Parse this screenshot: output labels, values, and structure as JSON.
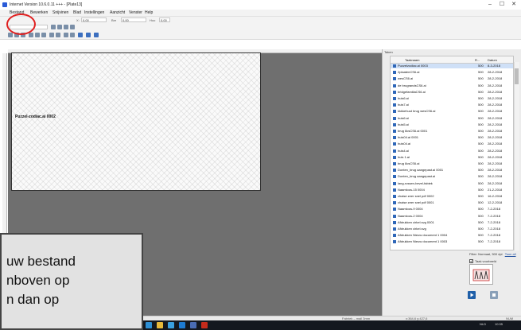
{
  "window": {
    "title": "Internet Version 10.6.0.11 +++ - [Plate13]",
    "controls": [
      "–",
      "☐",
      "✕"
    ]
  },
  "menu": [
    "Bestand",
    "Bewerken",
    "Snijvinen",
    "Blad",
    "Instellingen",
    "Aanzicht",
    "Venster",
    "Help"
  ],
  "toolbar": {
    "x_label": "X:",
    "x_value": "0,00",
    "width_label": "Bre",
    "width_value": "0,00",
    "height_label": "Hoo",
    "height_value": "0,00"
  },
  "plate": {
    "label": "Puzzel-zodiac.ai 0002"
  },
  "panel": {
    "title": "Taken",
    "columns": [
      "Taaknaam",
      "R...",
      "Datum"
    ],
    "rows": [
      {
        "name": "Puzzelzodiac.ai 0003",
        "res": "500",
        "date": "8-3-2018",
        "selected": true
      },
      {
        "name": "2plaatenCS6.ai",
        "res": "500",
        "date": "28-2-2018"
      },
      {
        "name": "wesCS6.ai",
        "res": "500",
        "date": "28-2-2018"
      },
      {
        "name": "de brugrandsCS6.ai",
        "res": "500",
        "date": "28-2-2018"
      },
      {
        "name": "bridgefamiliaCS6.ai",
        "res": "500",
        "date": "28-2-2018"
      },
      {
        "name": "huis6.ai",
        "res": "500",
        "date": "28-2-2018"
      },
      {
        "name": "huis7.ai",
        "res": "500",
        "date": "28-2-2018"
      },
      {
        "name": "kkkkehuut brug wesCS6.ai",
        "res": "500",
        "date": "28-2-2018"
      },
      {
        "name": "huis6.ai",
        "res": "500",
        "date": "28-2-2018"
      },
      {
        "name": "huis5.ai",
        "res": "500",
        "date": "28-2-2018"
      },
      {
        "name": "brug 8csCS6.ai 0001",
        "res": "500",
        "date": "28-2-2018"
      },
      {
        "name": "huis04.ai 0001",
        "res": "500",
        "date": "28-2-2018"
      },
      {
        "name": "huis04.ai",
        "res": "500",
        "date": "28-2-2018"
      },
      {
        "name": "huis4.ai",
        "res": "500",
        "date": "28-2-2018"
      },
      {
        "name": "huis 1.ai",
        "res": "500",
        "date": "28-2-2018"
      },
      {
        "name": "brug 8csCS6.ai",
        "res": "500",
        "date": "28-2-2018"
      },
      {
        "name": "Donten_brug aangepast.ai 0001",
        "res": "500",
        "date": "28-2-2018"
      },
      {
        "name": "Donten_brug aangepast.ai",
        "res": "500",
        "date": "28-2-2018"
      },
      {
        "name": "lang-rossen-bevel-fabiek",
        "res": "500",
        "date": "28-2-2018"
      },
      {
        "name": "Naamloos-15 0004",
        "res": "500",
        "date": "21-2-2018"
      },
      {
        "name": "chaise zeer snel pdf 0002",
        "res": "500",
        "date": "16-2-2018"
      },
      {
        "name": "chaise zeer snel pdf 0001",
        "res": "500",
        "date": "12-2-2018"
      },
      {
        "name": "Naamloos-9 0004",
        "res": "500",
        "date": "7-2-2018"
      },
      {
        "name": "Naamloos-2 0004",
        "res": "500",
        "date": "7-2-2018"
      },
      {
        "name": "Afdrukken cirkel.svg 0001",
        "res": "500",
        "date": "7-2-2018"
      },
      {
        "name": "Afdrukken cirkel.svg",
        "res": "500",
        "date": "7-2-2018"
      },
      {
        "name": "Afdrukken Nieuw document 1 0004",
        "res": "500",
        "date": "7-2-2018"
      },
      {
        "name": "Afdrukken Nieuw document 1 0003",
        "res": "500",
        "date": "7-2-2018"
      }
    ],
    "filter": "Filter: Normaal, 500 dpi",
    "filter_link": "Toon all",
    "preview_label": "Taak voorbeeld"
  },
  "status": {
    "left": "Fabriek – mail 3mm",
    "coords": "x:364,6  y:427,6",
    "right": "NUM"
  },
  "taskbar": {
    "time": "10:35",
    "lang": "NLD"
  },
  "tip": {
    "lines": [
      "uw bestand",
      "nboven op",
      "n dan op"
    ]
  },
  "colors": {
    "annotation": "#e02020",
    "accent": "#2f67b8"
  }
}
